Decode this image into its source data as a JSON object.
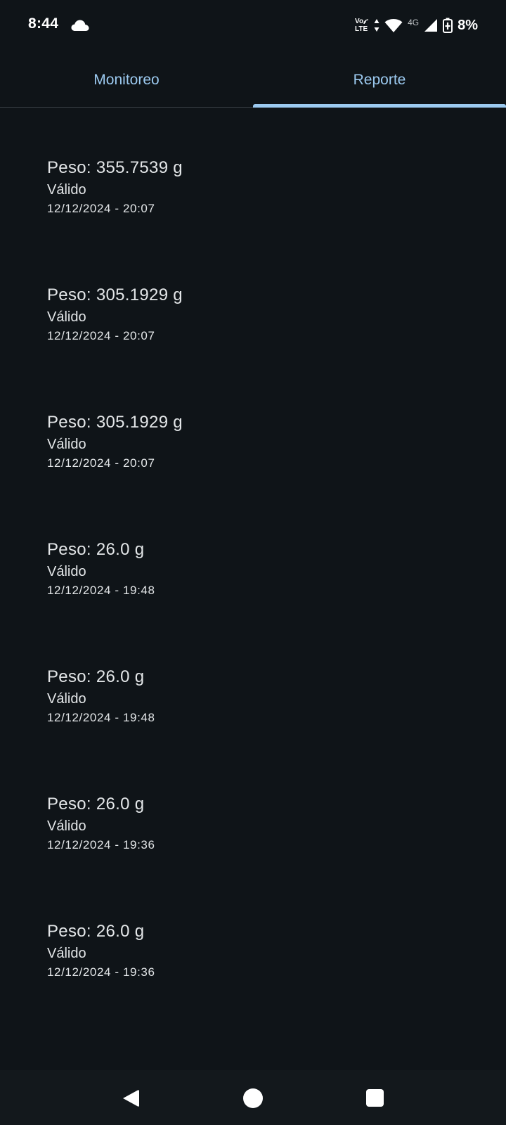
{
  "status_bar": {
    "time": "8:44",
    "volte_top": "Vo",
    "volte_bottom": "LTE",
    "network": "4G",
    "battery": "8%",
    "icons": [
      "cloud-icon",
      "data-arrows-icon",
      "wifi-icon",
      "cell-signal-icon",
      "battery-charging-icon"
    ]
  },
  "tabs": [
    {
      "label": "Monitoreo",
      "selected": false
    },
    {
      "label": "Reporte",
      "selected": true
    }
  ],
  "accent_color": "#9ccaf0",
  "background_color": "#0f1418",
  "reports": [
    {
      "weight": "Peso: 355.7539 g",
      "status": "Válido",
      "datetime": "12/12/2024 - 20:07"
    },
    {
      "weight": "Peso: 305.1929 g",
      "status": "Válido",
      "datetime": "12/12/2024 - 20:07"
    },
    {
      "weight": "Peso: 305.1929 g",
      "status": "Válido",
      "datetime": "12/12/2024 - 20:07"
    },
    {
      "weight": "Peso: 26.0 g",
      "status": "Válido",
      "datetime": "12/12/2024 - 19:48"
    },
    {
      "weight": "Peso: 26.0 g",
      "status": "Válido",
      "datetime": "12/12/2024 - 19:48"
    },
    {
      "weight": "Peso: 26.0 g",
      "status": "Válido",
      "datetime": "12/12/2024 - 19:36"
    },
    {
      "weight": "Peso: 26.0 g",
      "status": "Válido",
      "datetime": "12/12/2024 - 19:36"
    }
  ],
  "nav_bar": {
    "icons": [
      "back-icon",
      "home-icon",
      "recents-icon"
    ]
  }
}
